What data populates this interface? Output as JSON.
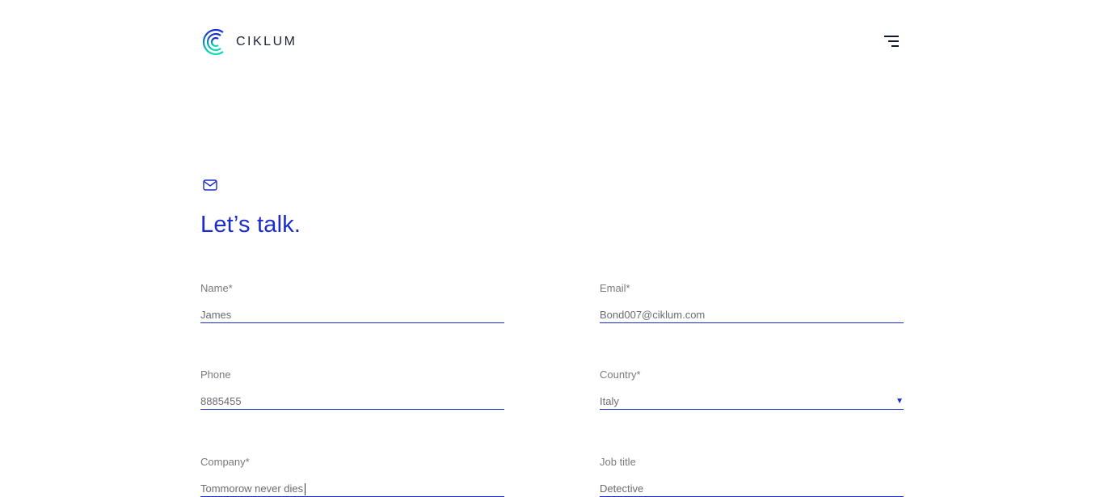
{
  "header": {
    "brand": "CIKLUM",
    "menu_icon": "hamburger-icon"
  },
  "contact": {
    "icon": "mail-icon",
    "title": "Let’s talk.",
    "fields": {
      "name": {
        "label": "Name*",
        "value": "James"
      },
      "email": {
        "label": "Email*",
        "value": "Bond007@ciklum.com"
      },
      "phone": {
        "label": "Phone",
        "value": "8885455"
      },
      "country": {
        "label": "Country*",
        "value": "Italy"
      },
      "company": {
        "label": "Company*",
        "value": "Tommorow never dies"
      },
      "job_title": {
        "label": "Job title",
        "value": "Detective"
      }
    }
  },
  "colors": {
    "accent": "#1a2ccc",
    "text": "#6b6b72"
  }
}
